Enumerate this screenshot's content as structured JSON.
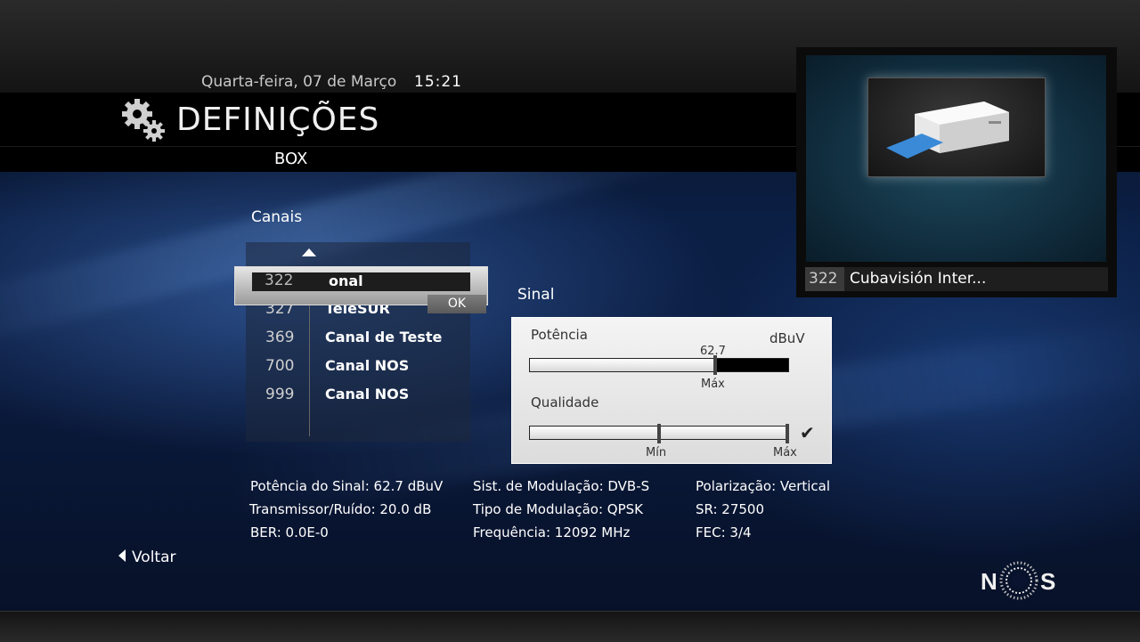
{
  "header": {
    "date": "Quarta-feira, 07 de Março",
    "time": "15:21",
    "title": "DEFINIÇÕES",
    "subtitle": "BOX"
  },
  "preview": {
    "channel_number": "322",
    "channel_name": "Cubavisión Inter..."
  },
  "channels": {
    "label": "Canais",
    "selected": {
      "number": "322",
      "name": "onal",
      "ok_label": "OK"
    },
    "items": [
      {
        "number": "327",
        "name": "TeleSUR"
      },
      {
        "number": "369",
        "name": "Canal de Teste"
      },
      {
        "number": "700",
        "name": "Canal NOS"
      },
      {
        "number": "999",
        "name": "Canal NOS"
      }
    ]
  },
  "signal": {
    "label": "Sinal",
    "power": {
      "label": "Potência",
      "unit": "dBuV",
      "value": "62.7",
      "max_label": "Máx",
      "fill_fraction": 0.72
    },
    "quality": {
      "label": "Qualidade",
      "min_label": "Mín",
      "max_label": "Máx",
      "fill_fraction": 1.0
    }
  },
  "info": {
    "col1": [
      "Potência do Sinal:  62.7 dBuV",
      "Transmissor/Ruído: 20.0 dB",
      "BER:  0.0E-0"
    ],
    "col2": [
      "Sist. de Modulação: DVB-S",
      "Tipo de Modulação: QPSK",
      "Frequência: 12092 MHz"
    ],
    "col3": [
      "Polarização: Vertical",
      "SR: 27500",
      "FEC: 3/4"
    ]
  },
  "nav": {
    "back_label": "Voltar"
  },
  "brand": {
    "logo_text_left": "N",
    "logo_text_right": "S"
  }
}
